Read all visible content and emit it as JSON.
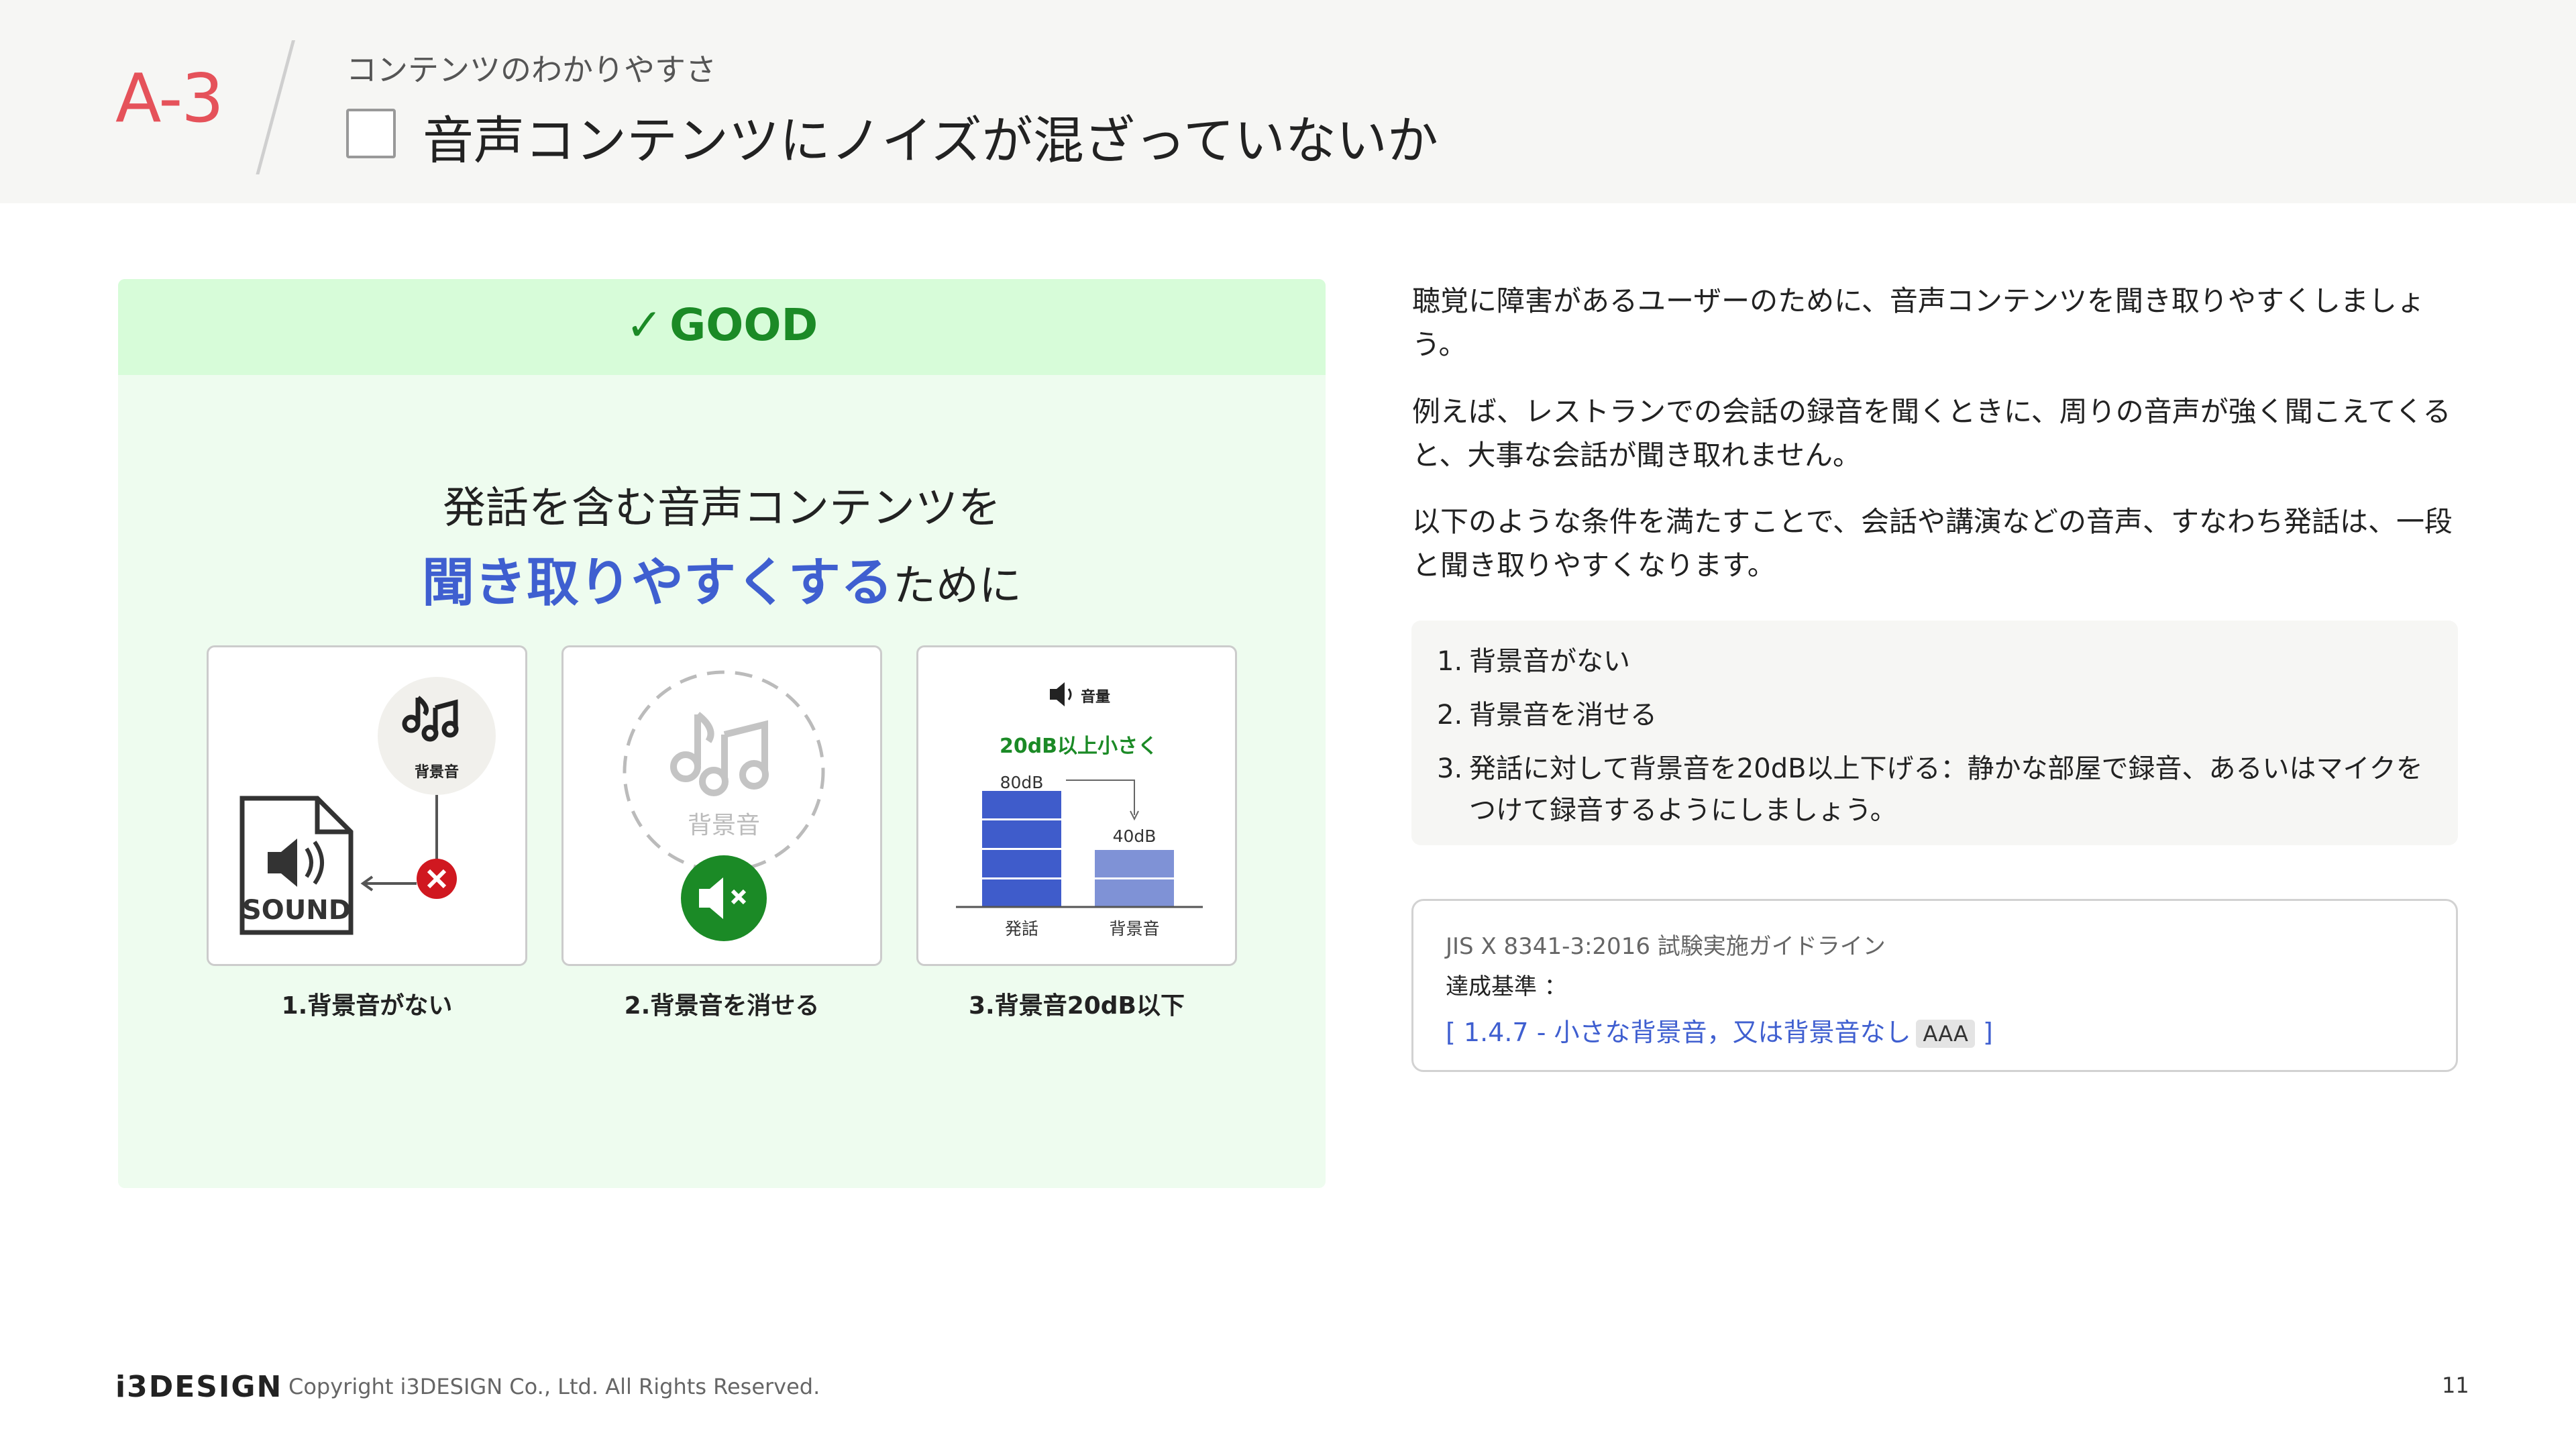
{
  "header": {
    "code": "A-3",
    "subtitle": "コンテンツのわかりやすさ",
    "title": "音声コンテンツにノイズが混ざっていないか"
  },
  "panel": {
    "badge_check": "✓",
    "badge": "GOOD",
    "line1": "発話を含む音声コンテンツを",
    "line2_emphasis": "聞き取りやすくする",
    "line2_rest": "ために",
    "cards": [
      {
        "caption": "1.背景音がない",
        "note_label": "背景音",
        "file_label": "SOUND"
      },
      {
        "caption": "2.背景音を消せる",
        "circle_label": "背景音"
      },
      {
        "caption": "3.背景音20dB以下",
        "speaker_label": "音量",
        "headline": "20dB以上小さく",
        "bars": [
          {
            "label": "発話",
            "value_label": "80dB",
            "value": 80
          },
          {
            "label": "背景音",
            "value_label": "40dB",
            "value": 40
          }
        ]
      }
    ]
  },
  "description": {
    "p1": "聴覚に障害があるユーザーのために、音声コンテンツを聞き取りやすくしましょう。",
    "p2": "例えば、レストランでの会話の録音を聞くときに、周りの音声が強く聞こえてくると、大事な会話が聞き取れません。",
    "p3": "以下のような条件を満たすことで、会話や講演などの音声、すなわち発話は、一段と聞き取りやすくなります。"
  },
  "conditions": [
    {
      "num": "1.",
      "text": "背景音がない"
    },
    {
      "num": "2.",
      "text": "背景音を消せる"
    },
    {
      "num": "3.",
      "text": "発話に対して背景音を20dB以上下げる：静かな部屋で録音、あるいはマイクをつけて録音するようにしましょう。"
    }
  ],
  "reference": {
    "source": "JIS X 8341-3:2016 試験実施ガイドライン",
    "label": "達成基準 ：",
    "link_open": "[",
    "link_text": "1.4.7 - 小さな背景音，又は背景音なし",
    "level": "AAA",
    "link_close": "]"
  },
  "footer": {
    "logo": "i3DESIGN",
    "copyright": "Copyright i3DESIGN Co., Ltd. All Rights Reserved.",
    "page": "11"
  },
  "colors": {
    "accent_red": "#e5525a",
    "good_green": "#1b8a26",
    "link_blue": "#3f5fd0",
    "bar_speech": "#3f5ccb",
    "bar_background": "#7f92d6"
  }
}
